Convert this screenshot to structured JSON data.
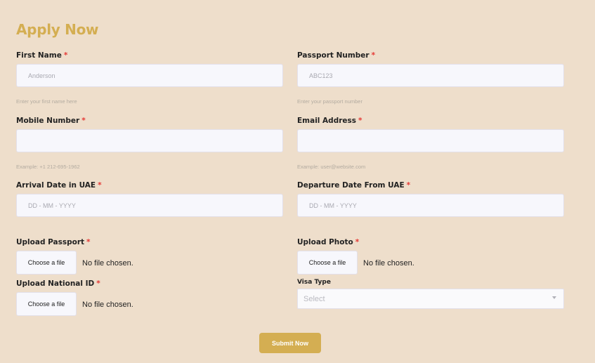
{
  "form": {
    "title": "Apply Now",
    "required_mark": "*",
    "first_name": {
      "label": "First Name",
      "placeholder": "Anderson",
      "hint": "Enter your first name here"
    },
    "passport_number": {
      "label": "Passport Number",
      "placeholder": "ABC123",
      "hint": "Enter your passport number"
    },
    "mobile_number": {
      "label": "Mobile Number",
      "placeholder": "",
      "hint": "Example: +1 212-695-1962"
    },
    "email_address": {
      "label": "Email Address",
      "placeholder": "",
      "hint": "Example: user@website.com"
    },
    "arrival_date": {
      "label": "Arrival Date in UAE",
      "placeholder": "DD - MM - YYYY"
    },
    "departure_date": {
      "label": "Departure Date From UAE",
      "placeholder": "DD - MM - YYYY"
    },
    "upload_passport": {
      "label": "Upload Passport",
      "button": "Choose a file",
      "status": "No file chosen."
    },
    "upload_photo": {
      "label": "Upload Photo",
      "button": "Choose a file",
      "status": "No file chosen."
    },
    "upload_national_id": {
      "label": "Upload National ID",
      "button": "Choose a file",
      "status": "No file chosen."
    },
    "visa_type": {
      "label": "Visa Type",
      "value": "Select",
      "icon": "chevron-down-icon"
    },
    "submit_label": "Submit Now"
  },
  "colors": {
    "background": "#eedecb",
    "accent": "#d4ae52",
    "required": "#e53935",
    "input_bg": "#f7f7fc"
  }
}
